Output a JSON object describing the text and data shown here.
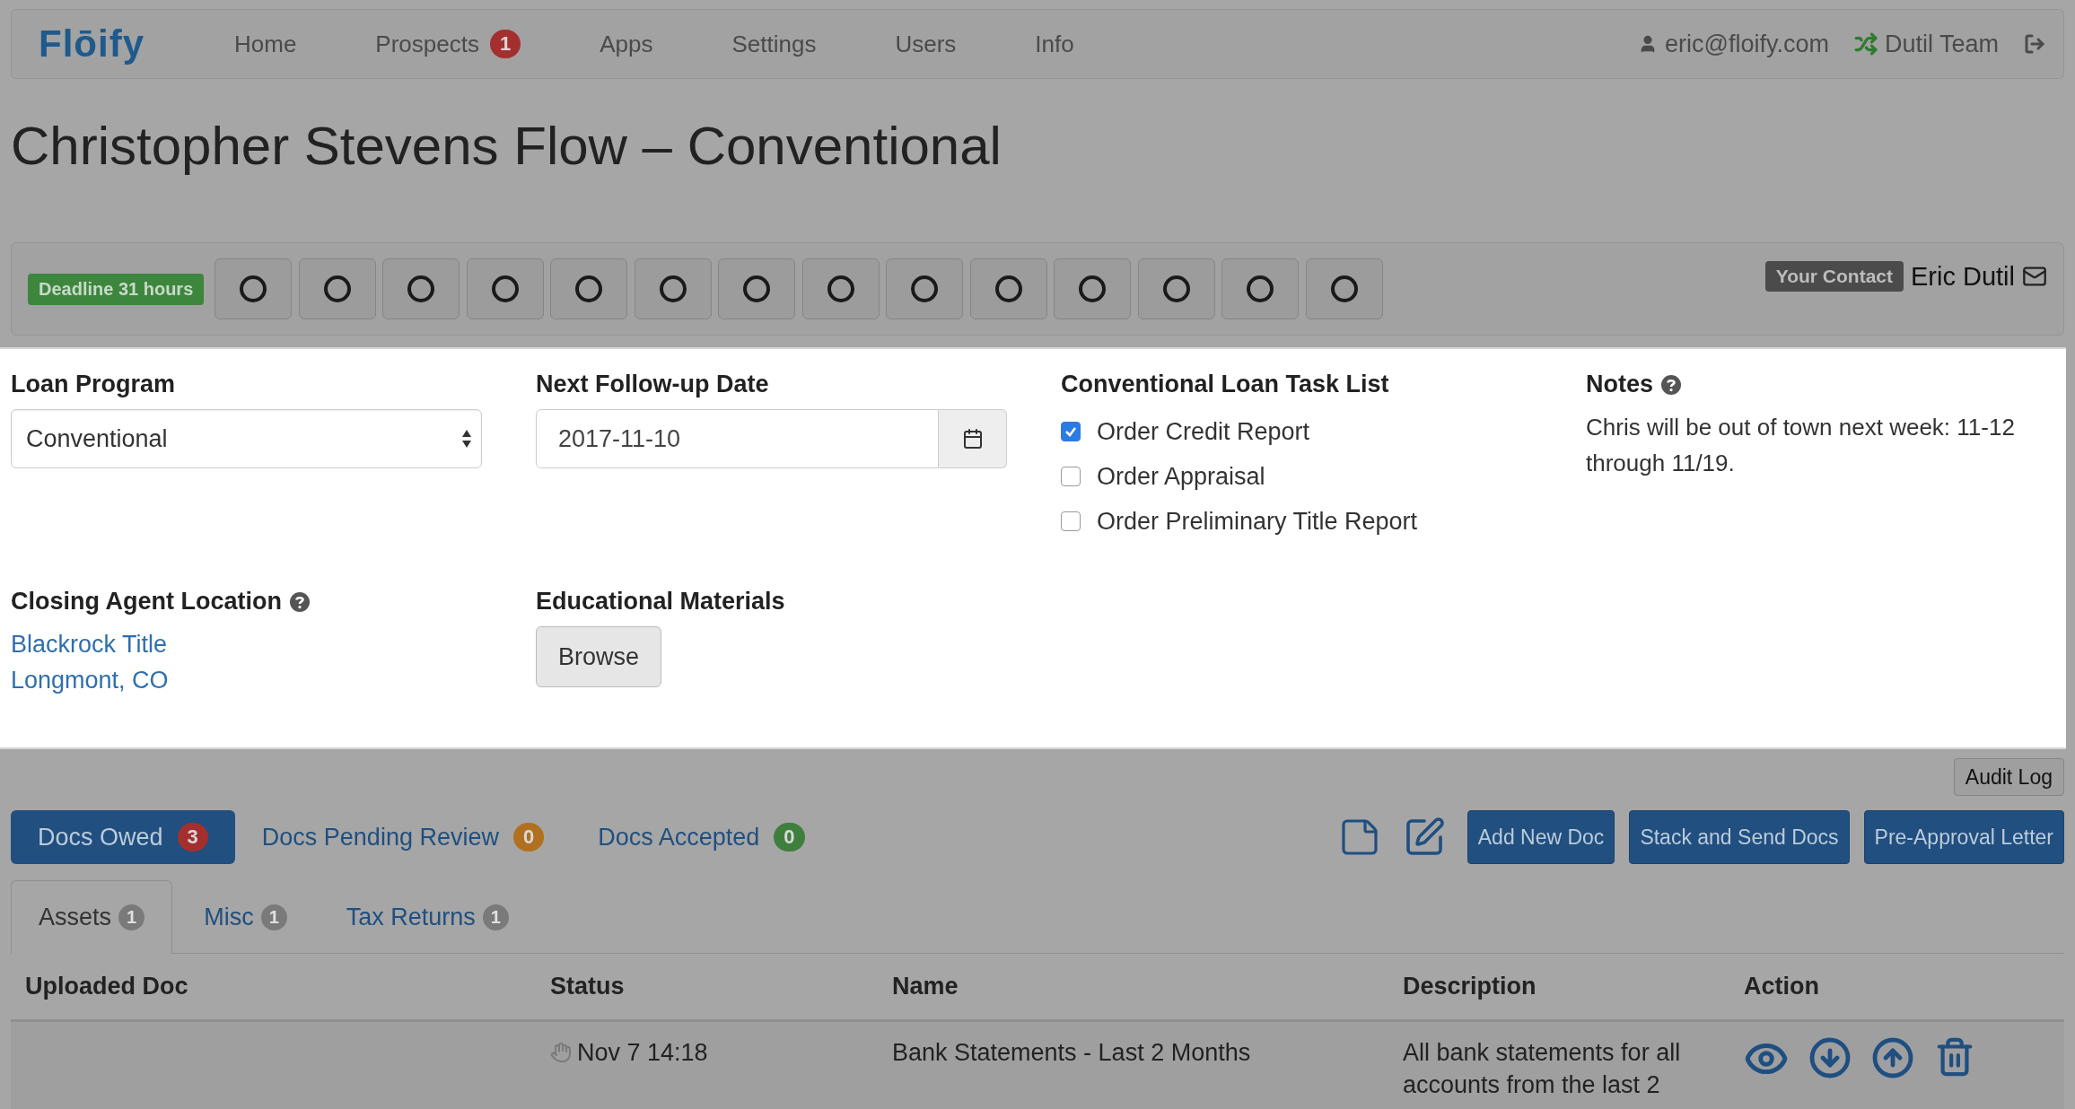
{
  "nav": {
    "logo": "Flōify",
    "items": [
      {
        "label": "Home"
      },
      {
        "label": "Prospects",
        "badge": "1"
      },
      {
        "label": "Apps"
      },
      {
        "label": "Settings"
      },
      {
        "label": "Users"
      },
      {
        "label": "Info"
      }
    ],
    "user": "eric@floify.com",
    "team": "Dutil Team"
  },
  "title": "Christopher Stevens Flow – Conventional",
  "progress": {
    "deadline": "Deadline 31 hours",
    "steps": [
      {
        "kind": "pending"
      },
      {
        "kind": "pending"
      },
      {
        "kind": "pending"
      },
      {
        "kind": "pending"
      },
      {
        "kind": "pending"
      },
      {
        "kind": "pending"
      },
      {
        "kind": "pending"
      },
      {
        "kind": "pending"
      },
      {
        "kind": "pending"
      },
      {
        "kind": "pending"
      },
      {
        "kind": "pending"
      },
      {
        "kind": "pending"
      },
      {
        "kind": "pending"
      },
      {
        "kind": "pending"
      }
    ],
    "contact_label": "Your Contact",
    "contact_name": "Eric Dutil"
  },
  "form": {
    "loan_program": {
      "label": "Loan Program",
      "value": "Conventional"
    },
    "follow_up": {
      "label": "Next Follow-up Date",
      "value": "2017-11-10"
    },
    "task_list": {
      "title": "Conventional Loan Task List",
      "tasks": [
        {
          "label": "Order Credit Report",
          "checked": true
        },
        {
          "label": "Order Appraisal",
          "checked": false
        },
        {
          "label": "Order Preliminary Title Report",
          "checked": false
        }
      ]
    },
    "notes": {
      "title": "Notes",
      "text": "Chris will be out of town next week: 11-12 through 11/19."
    },
    "closing_agent": {
      "label": "Closing Agent Location",
      "lines": [
        "Blackrock Title",
        "Longmont, CO"
      ]
    },
    "educational": {
      "label": "Educational Materials",
      "button": "Browse"
    }
  },
  "docs": {
    "audit_log": "Audit Log",
    "tabs": [
      {
        "label": "Docs Owed",
        "count": "3",
        "color": "#a3302e",
        "selected": true
      },
      {
        "label": "Docs Pending Review",
        "count": "0",
        "color": "#b0701f",
        "selected": false
      },
      {
        "label": "Docs Accepted",
        "count": "0",
        "color": "#3e7f3e",
        "selected": false
      }
    ],
    "buttons": [
      "Add New Doc",
      "Stack and Send Docs",
      "Pre-Approval Letter"
    ],
    "subtabs": [
      {
        "label": "Assets",
        "count": "1",
        "selected": true
      },
      {
        "label": "Misc",
        "count": "1",
        "selected": false
      },
      {
        "label": "Tax Returns",
        "count": "1",
        "selected": false
      }
    ],
    "table": {
      "columns": [
        "Uploaded Doc",
        "Status",
        "Name",
        "Description",
        "Action"
      ],
      "rows": [
        {
          "status": "Nov 7 14:18",
          "name": "Bank Statements - Last 2 Months",
          "description": "All bank statements for all accounts from the last 2"
        }
      ]
    }
  }
}
